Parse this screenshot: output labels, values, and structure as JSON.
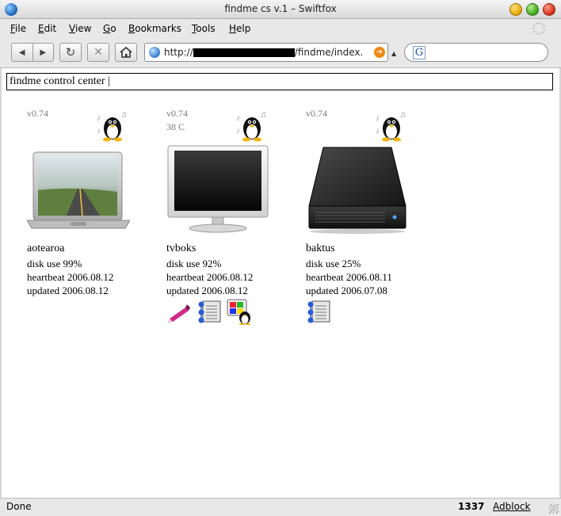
{
  "window": {
    "title": "findme cs v.1 – Swiftfox"
  },
  "menu": [
    "File",
    "Edit",
    "View",
    "Go",
    "Bookmarks",
    "Tools",
    "Help"
  ],
  "nav": {
    "url_prefix": "http://",
    "url_suffix": "/findme/index.",
    "search_engine": "G",
    "search_value": ""
  },
  "page": {
    "command_value": "findme control center |",
    "machines": [
      {
        "version": "v0.74",
        "temp": "",
        "name": "aotearoa",
        "device": "laptop",
        "disk": "disk use 99%",
        "heartbeat": "heartbeat 2006.08.12",
        "updated": "updated 2006.08.12",
        "apps": []
      },
      {
        "version": "v0.74",
        "temp": "38 C",
        "name": "tvboks",
        "device": "monitor",
        "disk": "disk use 92%",
        "heartbeat": "heartbeat 2006.08.12",
        "updated": "updated 2006.08.12",
        "apps": [
          "pen-icon",
          "network-monitor-icon",
          "linux-desktop-icon"
        ]
      },
      {
        "version": "v0.74",
        "temp": "",
        "name": "baktus",
        "device": "harddrive",
        "disk": "disk use 25%",
        "heartbeat": "heartbeat 2006.08.11",
        "updated": "updated 2006.07.08",
        "apps": [
          "network-monitor-icon"
        ]
      }
    ]
  },
  "status": {
    "text": "Done",
    "count": "1337",
    "adblock": "Adblock"
  }
}
